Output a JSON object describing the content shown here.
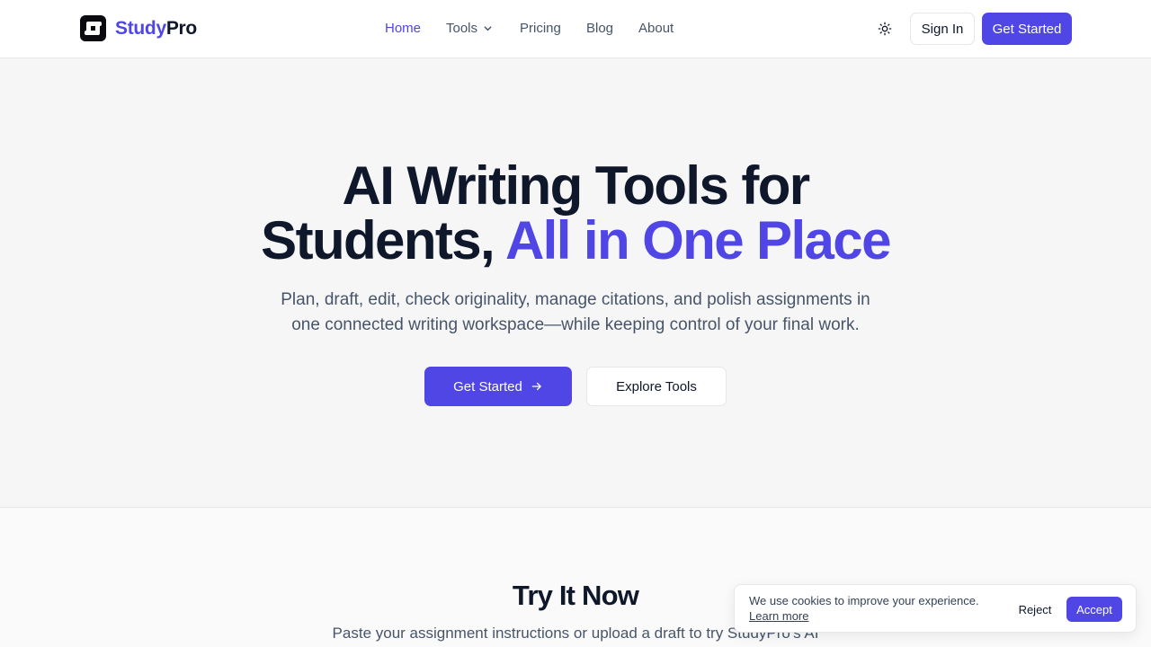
{
  "brand": {
    "name_part1": "Study",
    "name_part2": "Pro",
    "accent_color": "#4f46e5"
  },
  "nav": {
    "items": [
      {
        "label": "Home",
        "active": true
      },
      {
        "label": "Tools",
        "dropdown": true
      },
      {
        "label": "Pricing"
      },
      {
        "label": "Blog"
      },
      {
        "label": "About"
      }
    ]
  },
  "header_actions": {
    "theme_icon": "sun-icon",
    "sign_in": "Sign In",
    "get_started": "Get Started"
  },
  "hero": {
    "title_line1": "AI Writing Tools for",
    "title_line2_plain": "Students, ",
    "title_line2_accent": "All in One Place",
    "subtitle_line1": "Plan, draft, edit, check originality, manage citations, and polish assignments in",
    "subtitle_line2": "one connected writing workspace—while keeping control of your final work.",
    "cta_primary": "Get Started",
    "cta_secondary": "Explore Tools"
  },
  "try_section": {
    "title": "Try It Now",
    "subtitle": "Paste your assignment instructions or upload a draft to try StudyPro's AI"
  },
  "cookie": {
    "message": "We use cookies to improve your experience.",
    "learn_more": "Learn more",
    "reject": "Reject",
    "accept": "Accept"
  }
}
